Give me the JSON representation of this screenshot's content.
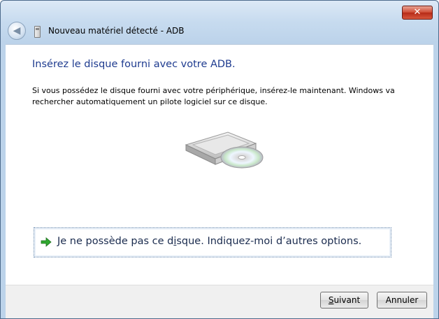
{
  "window": {
    "title": "Nouveau matériel détecté - ADB",
    "close_glyph": "✕",
    "back_glyph": "◀"
  },
  "main": {
    "heading": "Insérez le disque fourni avec votre ADB.",
    "description": "Si vous possédez le disque fourni avec votre périphérique, insérez-le maintenant. Windows va rechercher automatiquement un pilote logiciel sur ce disque.",
    "option": {
      "label_before": "Je ne possède pas ce d",
      "label_underlined": "i",
      "label_after": "sque. Indiquez-moi d’autres options.",
      "icon": "green-arrow-icon"
    },
    "illustration": "disc-drive-icon"
  },
  "footer": {
    "next_underlined": "S",
    "next_rest": "uivant",
    "cancel_label": "Annuler"
  },
  "colors": {
    "heading": "#1e3b8f",
    "title_bar": "#c7dbef",
    "accent_arrow": "#2fa82f"
  }
}
